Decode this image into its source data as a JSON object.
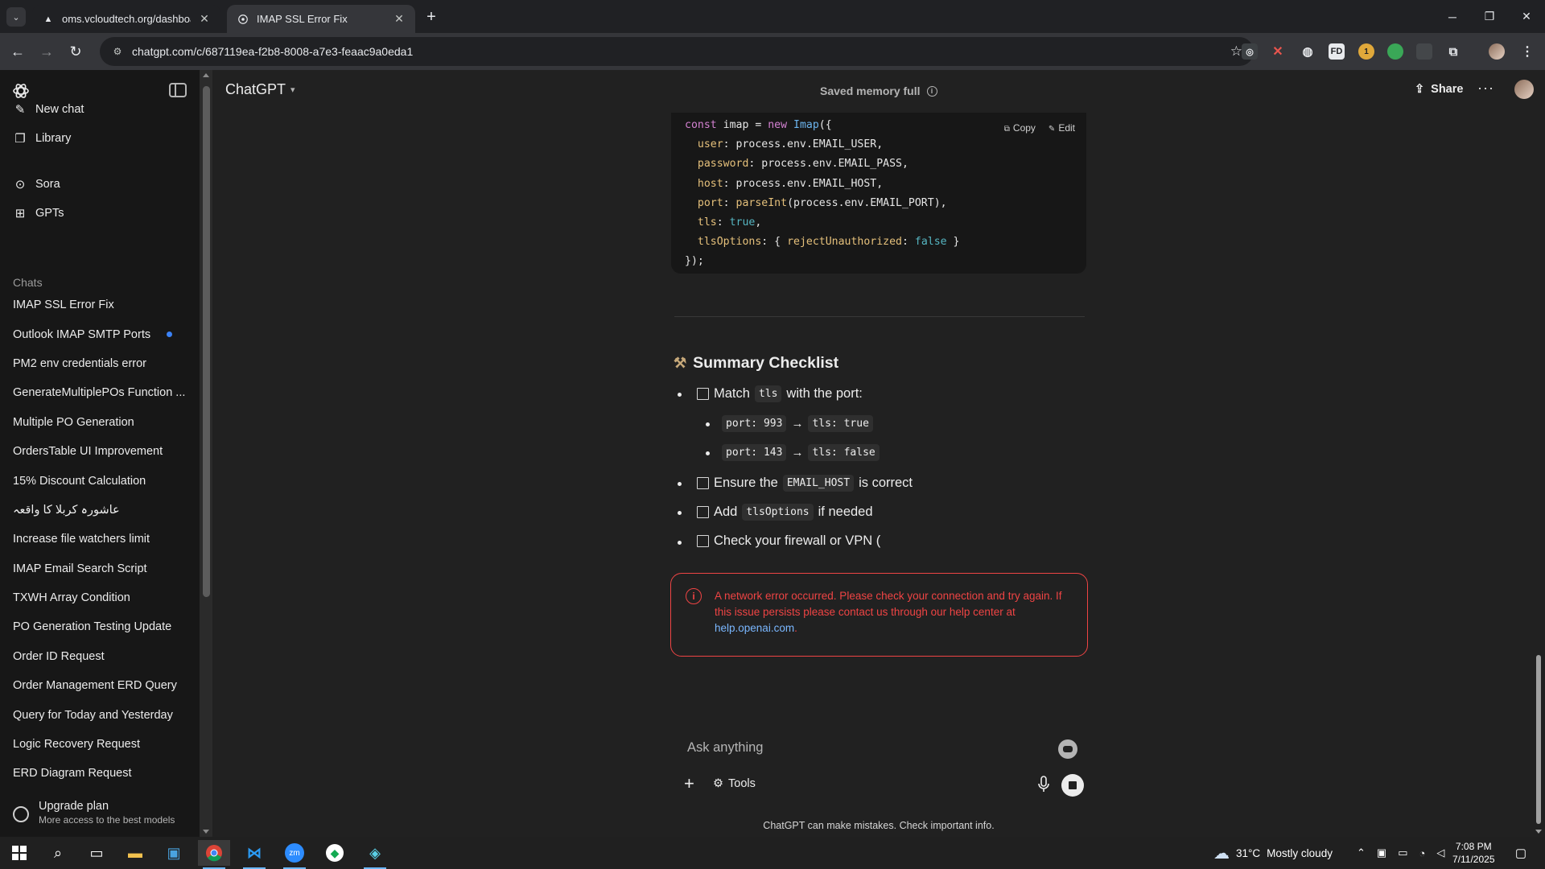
{
  "browser": {
    "tabs": [
      {
        "title": "oms.vcloudtech.org/dashboard",
        "active": false
      },
      {
        "title": "IMAP SSL Error Fix",
        "active": true
      }
    ],
    "url": "chatgpt.com/c/687119ea-f2b8-8008-a7e3-feaac9a0eda1",
    "extensions": [
      "FD"
    ],
    "extension_badge": "1"
  },
  "sidebar": {
    "nav": [
      {
        "label": "New chat",
        "icon": "edit-icon"
      },
      {
        "label": "Library",
        "icon": "library-icon"
      },
      {
        "label": "Sora",
        "icon": "play-icon"
      },
      {
        "label": "GPTs",
        "icon": "grid-icon"
      }
    ],
    "section_label": "Chats",
    "chats": [
      "IMAP SSL Error Fix",
      "Outlook IMAP SMTP Ports",
      "PM2 env credentials error",
      "GenerateMultiplePOs Function ...",
      "Multiple PO Generation",
      "OrdersTable UI Improvement",
      "15% Discount Calculation",
      "عاشورہ کربلا کا واقعہ",
      "Increase file watchers limit",
      "IMAP Email Search Script",
      "TXWH Array Condition",
      "PO Generation Testing Update",
      "Order ID Request",
      "Order Management ERD Query",
      "Query for Today and Yesterday",
      "Logic Recovery Request",
      "ERD Diagram Request"
    ],
    "upgrade": {
      "title": "Upgrade plan",
      "subtitle": "More access to the best models"
    }
  },
  "header": {
    "model": "ChatGPT",
    "memory": "Saved memory full",
    "share": "Share"
  },
  "code_block": {
    "actions": {
      "copy": "Copy",
      "edit": "Edit"
    }
  },
  "summary": {
    "title": "Summary Checklist",
    "items": [
      {
        "before": "Match",
        "code": "tls",
        "after": "with the port:"
      },
      {
        "before": "Ensure the",
        "code": "EMAIL_HOST",
        "after": "is correct"
      },
      {
        "before": "Add",
        "code": "tlsOptions",
        "after": "if needed"
      },
      {
        "before": "Check your firewall or VPN (",
        "code": "",
        "after": ""
      }
    ],
    "sub_items": [
      {
        "left": "port: 993",
        "arrow": "→",
        "right": "tls: true"
      },
      {
        "left": "port: 143",
        "arrow": "→",
        "right": "tls: false"
      }
    ]
  },
  "error": {
    "line1": "A network error occurred. Please check your connection and try again. If this issue persists please contact us through our help center at",
    "link": "help.openai.com",
    "tail": "."
  },
  "composer": {
    "placeholder": "Ask anything",
    "tools": "Tools",
    "footnote": "ChatGPT can make mistakes. Check important info."
  },
  "taskbar": {
    "weather_temp": "31°C",
    "weather_text": "Mostly cloudy",
    "time": "7:08 PM",
    "date": "7/11/2025"
  },
  "colors": {
    "error": "#ef4444",
    "link": "#7ab7ff",
    "unread_dot": "#3b82f6"
  }
}
